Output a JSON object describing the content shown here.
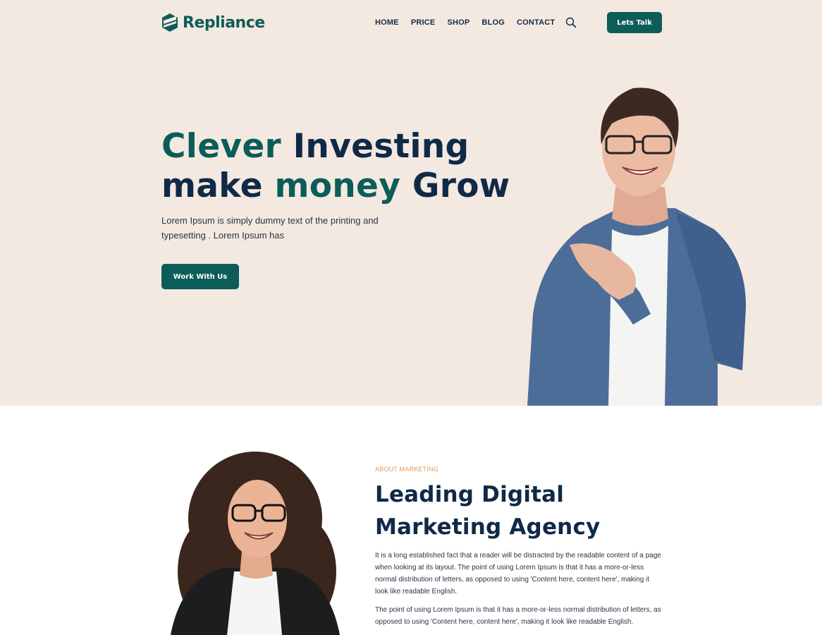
{
  "brand": {
    "name": "Repliance",
    "color": "#0c5d58"
  },
  "nav": {
    "items": [
      "HOME",
      "PRICE",
      "SHOP",
      "BLOG",
      "CONTACT"
    ],
    "search_icon": "search-icon",
    "cta_label": "Lets Talk"
  },
  "hero": {
    "title_line1_accent": "Clever",
    "title_line1_rest": " Investing",
    "title_line2_start": "make ",
    "title_line2_accent": "money",
    "title_line2_end": " Grow",
    "description": "Lorem Ipsum is simply dummy text of the printing and typesetting . Lorem Ipsum has",
    "button_label": "Work With Us",
    "background": "#f3e9e1"
  },
  "about": {
    "eyebrow": "ABOUT MARKETING",
    "title_line1": "Leading Digital",
    "title_line2": "Marketing Agency",
    "paragraph1": "It is a long established fact that a reader will be distracted by the readable content of a page when looking at its layout. The point of using Lorem Ipsum is that it has a more-or-less normal distribution of letters, as opposed to using 'Content here, content here', making it look like readable English.",
    "paragraph2": "The point of using Lorem Ipsum is that it has a more-or-less normal distribution of letters, as opposed to using 'Content here, content here', making it look like readable English.",
    "eyebrow_color": "#e39a5a"
  }
}
